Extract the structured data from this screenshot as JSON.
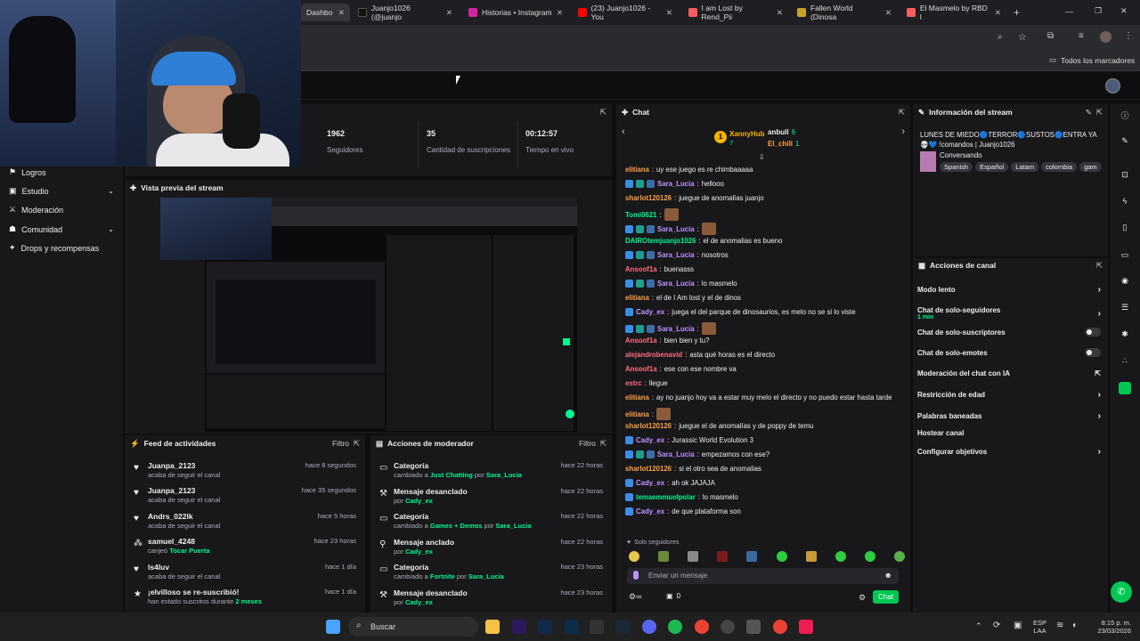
{
  "browser": {
    "tabs": [
      {
        "label": "Dashbo",
        "active": true
      },
      {
        "label": "Juanjo1026 (@juanjo",
        "active": false
      },
      {
        "label": "Historias • Instagram",
        "active": false
      },
      {
        "label": "(23) Juanjo1026 - You",
        "active": false
      },
      {
        "label": "I am Lost by Rend_Pii",
        "active": false
      },
      {
        "label": "Fallen World (Dinosa",
        "active": false
      },
      {
        "label": "El Masmelo by RBD l",
        "active": false
      }
    ],
    "new_tab": "+",
    "bookmarks_label": "Todos los marcadores"
  },
  "sidebar": {
    "items": [
      {
        "label": "Logros",
        "icon": "trophy-icon",
        "chevron": false
      },
      {
        "label": "Estudio",
        "icon": "studio-icon",
        "chevron": true
      },
      {
        "label": "Moderación",
        "icon": "sword-icon",
        "chevron": false
      },
      {
        "label": "Comunidad",
        "icon": "people-icon",
        "chevron": true
      },
      {
        "label": "Drops y recompensas",
        "icon": "gift-icon",
        "chevron": false
      }
    ]
  },
  "stats": [
    {
      "value": "1962",
      "label": "Seguidores"
    },
    {
      "value": "35",
      "label": "Cantidad de suscripciones"
    },
    {
      "value": "00:12:57",
      "label": "Tiempo en vivo"
    }
  ],
  "preview": {
    "title": "Vista previa del stream"
  },
  "feed": {
    "title": "Feed de actividades",
    "filter": "Filtro",
    "items": [
      {
        "name": "Juanpa_2123",
        "detail": "acaba de seguir el canal",
        "time": "hace 8 segundos",
        "icon": "heart-icon"
      },
      {
        "name": "Juanpa_2123",
        "detail": "acaba de seguir el canal",
        "time": "hace 35 segundos",
        "icon": "heart-icon"
      },
      {
        "name": "Andrs_022lk",
        "detail": "acaba de seguir el canal",
        "time": "hace 5 horas",
        "icon": "heart-icon"
      },
      {
        "name": "samuel_4248",
        "detail_prefix": "canjeó",
        "detail_highlight": "Tocar Puerta",
        "time": "hace 23 horas",
        "icon": "points-icon"
      },
      {
        "name": "ls4luv",
        "detail": "acaba de seguir el canal",
        "time": "hace 1 día",
        "icon": "heart-icon"
      },
      {
        "name": "¡elvilloso se re-suscribió!",
        "detail_prefix": "han estado suscritos durante",
        "detail_highlight": "2 meses",
        "time": "hace 1 día",
        "icon": "star-icon"
      }
    ]
  },
  "modactions": {
    "title": "Acciones de moderador",
    "filter": "Filtro",
    "by": "por",
    "items": [
      {
        "action": "Categoría",
        "pre": "cambiado a",
        "hl": "Just Chatting",
        "user": "Sara_Lucia",
        "time": "hace 22 horas"
      },
      {
        "action": "Mensaje desanclado",
        "pre": "",
        "hl": "",
        "user": "Cady_ex",
        "time": "hace 22 horas"
      },
      {
        "action": "Categoría",
        "pre": "cambiado a",
        "hl": "Games + Demos",
        "user": "Sara_Lucia",
        "time": "hace 22 horas"
      },
      {
        "action": "Mensaje anclado",
        "pre": "",
        "hl": "",
        "user": "Cady_ex",
        "time": "hace 22 horas"
      },
      {
        "action": "Categoría",
        "pre": "cambiado a",
        "hl": "Fortnite",
        "user": "Sara_Lucia",
        "time": "hace 23 horas"
      },
      {
        "action": "Mensaje desanclado",
        "pre": "",
        "hl": "",
        "user": "Cady_ex",
        "time": "hace 23 horas"
      }
    ]
  },
  "chat": {
    "title": "Chat",
    "gifters": [
      {
        "rank": "1",
        "name": "XannyHub",
        "count": "7"
      },
      {
        "rank": "",
        "name": "anbull",
        "count": "6"
      },
      {
        "rank": "",
        "name": "El_chili",
        "count": "1"
      }
    ],
    "messages": [
      {
        "user": "elitiana",
        "color": "#ff9f43",
        "text": "uy ese juego es re chimbaaaaa",
        "badges": 0,
        "emote": false
      },
      {
        "user": "Sara_Lucia",
        "color": "#bf94ff",
        "text": "hellooo",
        "badges": 3,
        "emote": false
      },
      {
        "user": "sharlot120126",
        "color": "#ff9f43",
        "text": "juegue de anomalías juanjo",
        "badges": 0,
        "emote": false
      },
      {
        "user": "Tomi0621",
        "color": "#00f593",
        "text": "",
        "badges": 0,
        "emote": true
      },
      {
        "user": "Sara_Lucia",
        "color": "#bf94ff",
        "text": "",
        "badges": 3,
        "emote": true
      },
      {
        "user": "DAIROtemjuanjo1026",
        "color": "#00f593",
        "text": "el de anomalias es bueno",
        "badges": 0,
        "emote": false
      },
      {
        "user": "Sara_Lucia",
        "color": "#bf94ff",
        "text": "nosotros",
        "badges": 3,
        "emote": false
      },
      {
        "user": "Ansoof1a",
        "color": "#ff6b81",
        "text": "buenasss",
        "badges": 0,
        "emote": false
      },
      {
        "user": "Sara_Lucia",
        "color": "#bf94ff",
        "text": "lo masmelo",
        "badges": 3,
        "emote": false
      },
      {
        "user": "elitiana",
        "color": "#ff9f43",
        "text": "el de I Am lost y el de dinos",
        "badges": 0,
        "emote": false
      },
      {
        "user": "Cady_ex",
        "color": "#bf94ff",
        "text": "juega el del parque de dinosaurios, es melo no se si lo viste",
        "badges": 1,
        "emote": false
      },
      {
        "user": "Sara_Lucia",
        "color": "#bf94ff",
        "text": "",
        "badges": 3,
        "emote": true
      },
      {
        "user": "Ansoof1a",
        "color": "#ff6b81",
        "text": "bien bien y tu?",
        "badges": 0,
        "emote": false
      },
      {
        "user": "alejandrobenavid",
        "color": "#ff6b81",
        "text": "asta qué horas es el directo",
        "badges": 0,
        "emote": false
      },
      {
        "user": "Ansoof1a",
        "color": "#ff6b81",
        "text": "ese con ese nombre va",
        "badges": 0,
        "emote": false
      },
      {
        "user": "estrc",
        "color": "#ff6b81",
        "text": "llegue",
        "badges": 0,
        "emote": false
      },
      {
        "user": "elitiana",
        "color": "#ff9f43",
        "text": "ay no juanjo hoy va a estar muy melo el directo y no puedo estar hasta tarde",
        "badges": 0,
        "emote": false
      },
      {
        "user": "elitiana",
        "color": "#ff9f43",
        "text": "",
        "badges": 0,
        "emote": true
      },
      {
        "user": "sharlot120126",
        "color": "#ff9f43",
        "text": "juegue el de anomalías y de poppy de temu",
        "badges": 0,
        "emote": false
      },
      {
        "user": "Cady_ex",
        "color": "#bf94ff",
        "text": "Jurassic World Evolution 3",
        "badges": 1,
        "emote": false
      },
      {
        "user": "Sara_Lucia",
        "color": "#bf94ff",
        "text": "empezamos con ese?",
        "badges": 3,
        "emote": false
      },
      {
        "user": "sharlot120126",
        "color": "#ff9f43",
        "text": "si el otro sea de anomalias",
        "badges": 0,
        "emote": false
      },
      {
        "user": "Cady_ex",
        "color": "#bf94ff",
        "text": "ah ok JAJAJA",
        "badges": 1,
        "emote": false
      },
      {
        "user": "temaemmuelpolar",
        "color": "#00f593",
        "text": "lo masmelo",
        "badges": 1,
        "emote": false
      },
      {
        "user": "Cady_ex",
        "color": "#bf94ff",
        "text": "de que plataforma son",
        "badges": 1,
        "emote": false
      }
    ],
    "mode": "Solo seguidores",
    "placeholder": "Enviar un mensaje",
    "points": "0",
    "send": "Chat"
  },
  "stream_info": {
    "title_label": "Información del stream",
    "title": "LUNES DE MIEDO🔵TERROR🔵SUSTOS🔵ENTRA YA 💀💙 !comandos | Juanjo1026",
    "category": "Conversando",
    "tags": [
      "Spanish",
      "Español",
      "Latam",
      "colombia",
      "gam"
    ]
  },
  "channel_actions": {
    "title": "Acciones de canal",
    "items": [
      {
        "label": "Modo lento",
        "sub": "",
        "ctl": "chevron"
      },
      {
        "label": "Chat de solo-seguidores",
        "sub": "1 min",
        "ctl": "chevron"
      },
      {
        "label": "Chat de solo-suscriptores",
        "sub": "",
        "ctl": "toggle"
      },
      {
        "label": "Chat de solo-emotes",
        "sub": "",
        "ctl": "toggle"
      },
      {
        "label": "Moderación del chat con IA",
        "sub": "",
        "ctl": "external"
      },
      {
        "label": "Restricción de edad",
        "sub": "",
        "ctl": "chevron"
      },
      {
        "label": "Palabras baneadas",
        "sub": "",
        "ctl": "chevron"
      },
      {
        "label": "Hostear canal",
        "sub": "",
        "ctl": "none"
      },
      {
        "label": "Configurar objetivos",
        "sub": "",
        "ctl": "chevron"
      }
    ]
  },
  "taskbar": {
    "search": "Buscar",
    "lang1": "ESP",
    "lang2": "LAA",
    "time": "8:15 p. m.",
    "date": "23/03/2026"
  },
  "colors": {
    "accent": "#00f593",
    "bg": "#0e0e10",
    "panel": "#18181b"
  }
}
